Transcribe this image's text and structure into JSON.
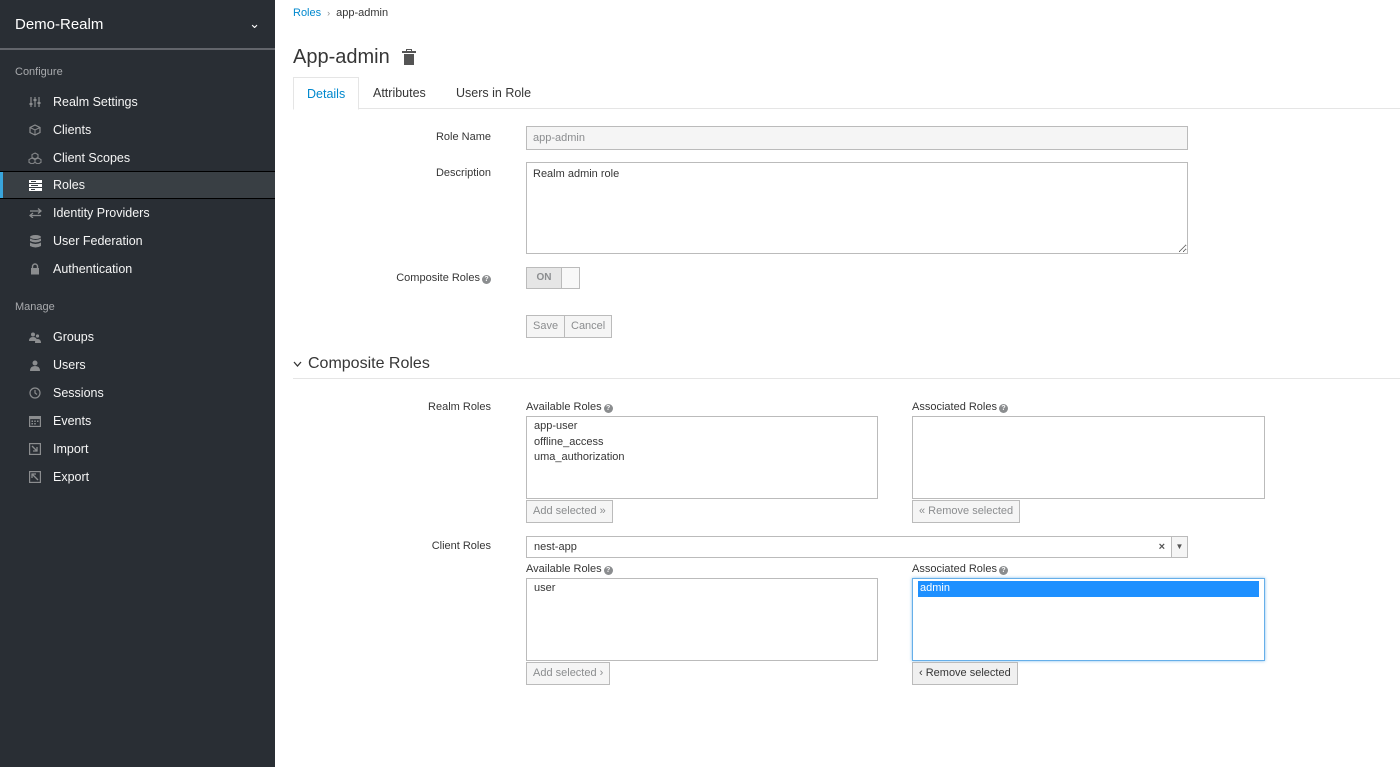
{
  "sidebar": {
    "realm": "Demo-Realm",
    "configure_header": "Configure",
    "manage_header": "Manage",
    "configure_items": [
      {
        "label": "Realm Settings",
        "icon": "sliders-icon"
      },
      {
        "label": "Clients",
        "icon": "cube-icon"
      },
      {
        "label": "Client Scopes",
        "icon": "cubes-icon"
      },
      {
        "label": "Roles",
        "icon": "list-icon",
        "active": true
      },
      {
        "label": "Identity Providers",
        "icon": "exchange-icon"
      },
      {
        "label": "User Federation",
        "icon": "database-icon"
      },
      {
        "label": "Authentication",
        "icon": "lock-icon"
      }
    ],
    "manage_items": [
      {
        "label": "Groups",
        "icon": "users-icon"
      },
      {
        "label": "Users",
        "icon": "user-icon"
      },
      {
        "label": "Sessions",
        "icon": "clock-icon"
      },
      {
        "label": "Events",
        "icon": "calendar-icon"
      },
      {
        "label": "Import",
        "icon": "import-icon"
      },
      {
        "label": "Export",
        "icon": "export-icon"
      }
    ]
  },
  "breadcrumb": {
    "parent": "Roles",
    "current": "app-admin"
  },
  "title": "App-admin",
  "tabs": [
    "Details",
    "Attributes",
    "Users in Role"
  ],
  "form": {
    "role_name_label": "Role Name",
    "role_name_value": "app-admin",
    "description_label": "Description",
    "description_value": "Realm admin role",
    "composite_label": "Composite Roles",
    "composite_state": "ON",
    "save_label": "Save",
    "cancel_label": "Cancel"
  },
  "composite": {
    "section_title": "Composite Roles",
    "realm_roles_label": "Realm Roles",
    "client_roles_label": "Client Roles",
    "available_label": "Available Roles",
    "associated_label": "Associated Roles",
    "realm_available": [
      "app-user",
      "offline_access",
      "uma_authorization"
    ],
    "realm_associated": [],
    "realm_add_label": "Add selected »",
    "realm_remove_label": "« Remove selected",
    "client_select_value": "nest-app",
    "client_available": [
      "user"
    ],
    "client_associated": [
      "admin"
    ],
    "client_add_label": "Add selected ›",
    "client_remove_label": "‹ Remove selected"
  },
  "colors": {
    "sidebar_bg": "#292e34",
    "accent": "#39a5dc",
    "link": "#0088ce",
    "selection": "#1e90ff"
  }
}
